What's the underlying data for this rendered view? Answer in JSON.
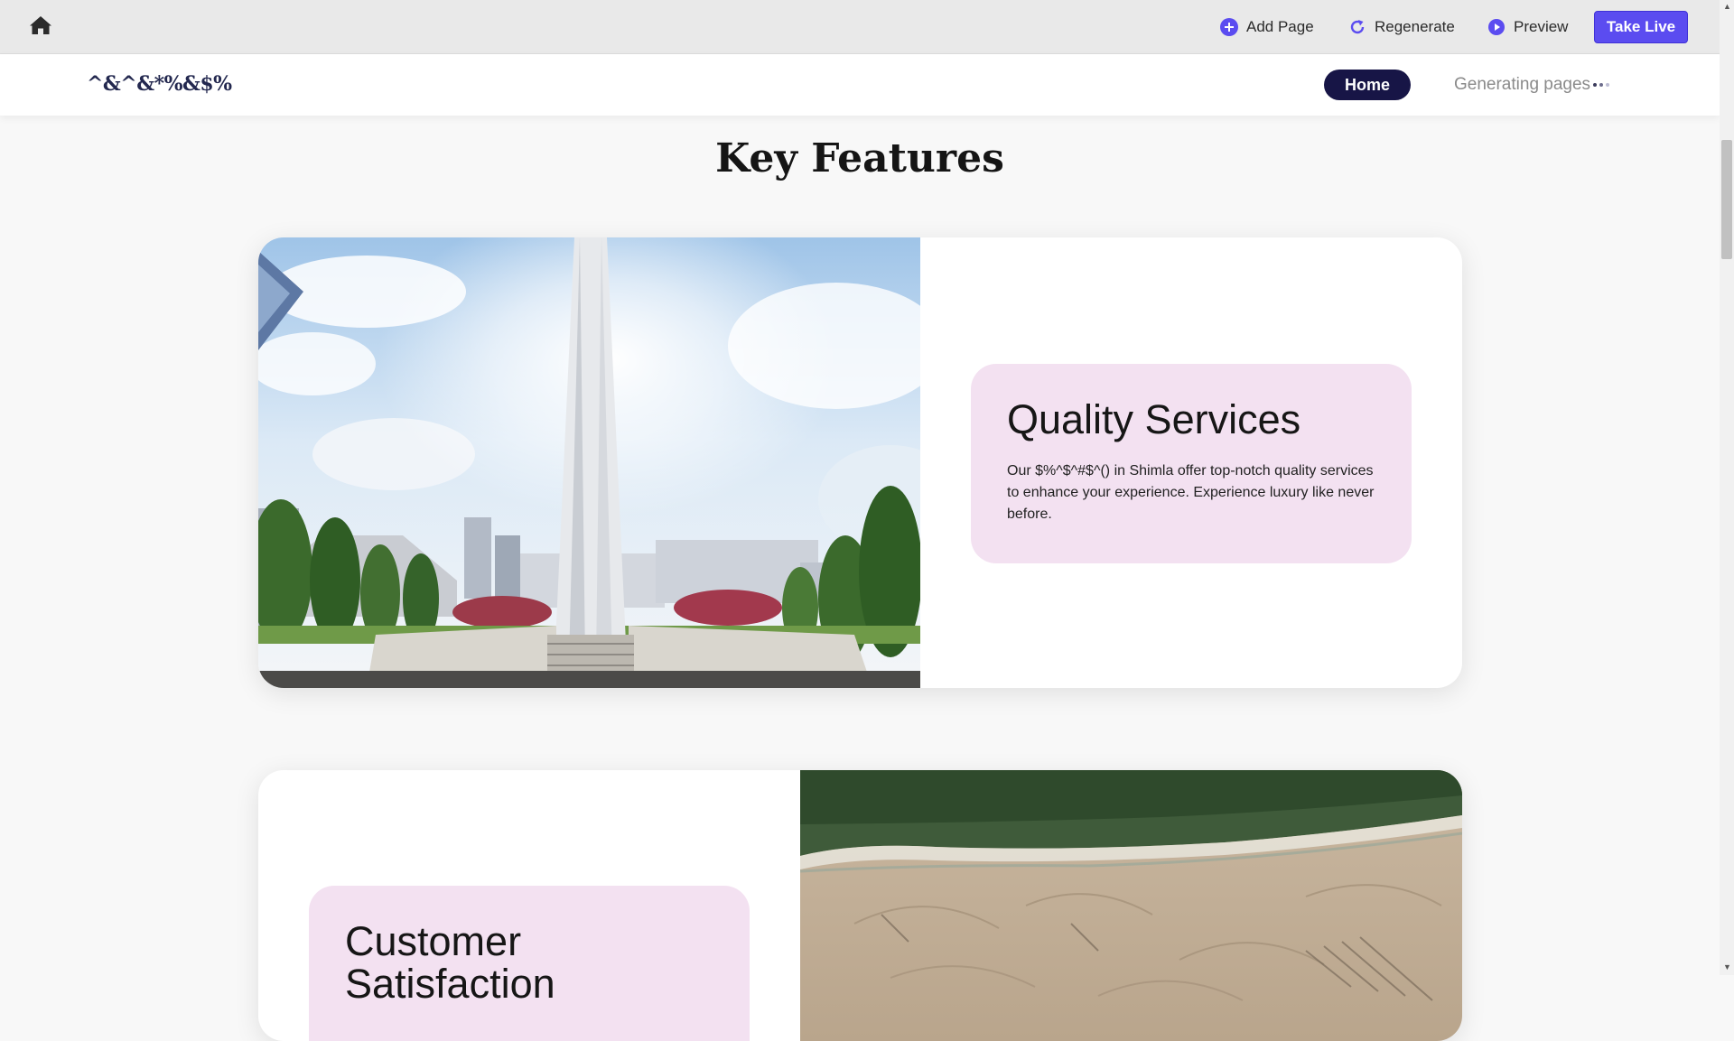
{
  "toolbar": {
    "add_page": "Add Page",
    "regenerate": "Regenerate",
    "preview": "Preview",
    "take_live": "Take Live",
    "accent": "#5b4cf0"
  },
  "nav": {
    "logo": "^&^&*%&$%",
    "home": "Home",
    "generating": "Generating pages",
    "home_bg": "#171546"
  },
  "section": {
    "title": "Key Features"
  },
  "features": [
    {
      "title": "Quality Services",
      "description": "Our $%^$^#$^() in Shimla offer top-notch quality services to enhance your experience. Experience luxury like never before.",
      "image": "memorial-obelisk-park-photo"
    },
    {
      "title": "Customer Satisfaction",
      "image": "aerial-beach-photo"
    }
  ],
  "icons": [
    "home-icon",
    "plus-circle-icon",
    "refresh-icon",
    "play-circle-icon"
  ],
  "colors": {
    "feature_box": "#f3e1f1",
    "page_bg": "#f8f8f8"
  }
}
